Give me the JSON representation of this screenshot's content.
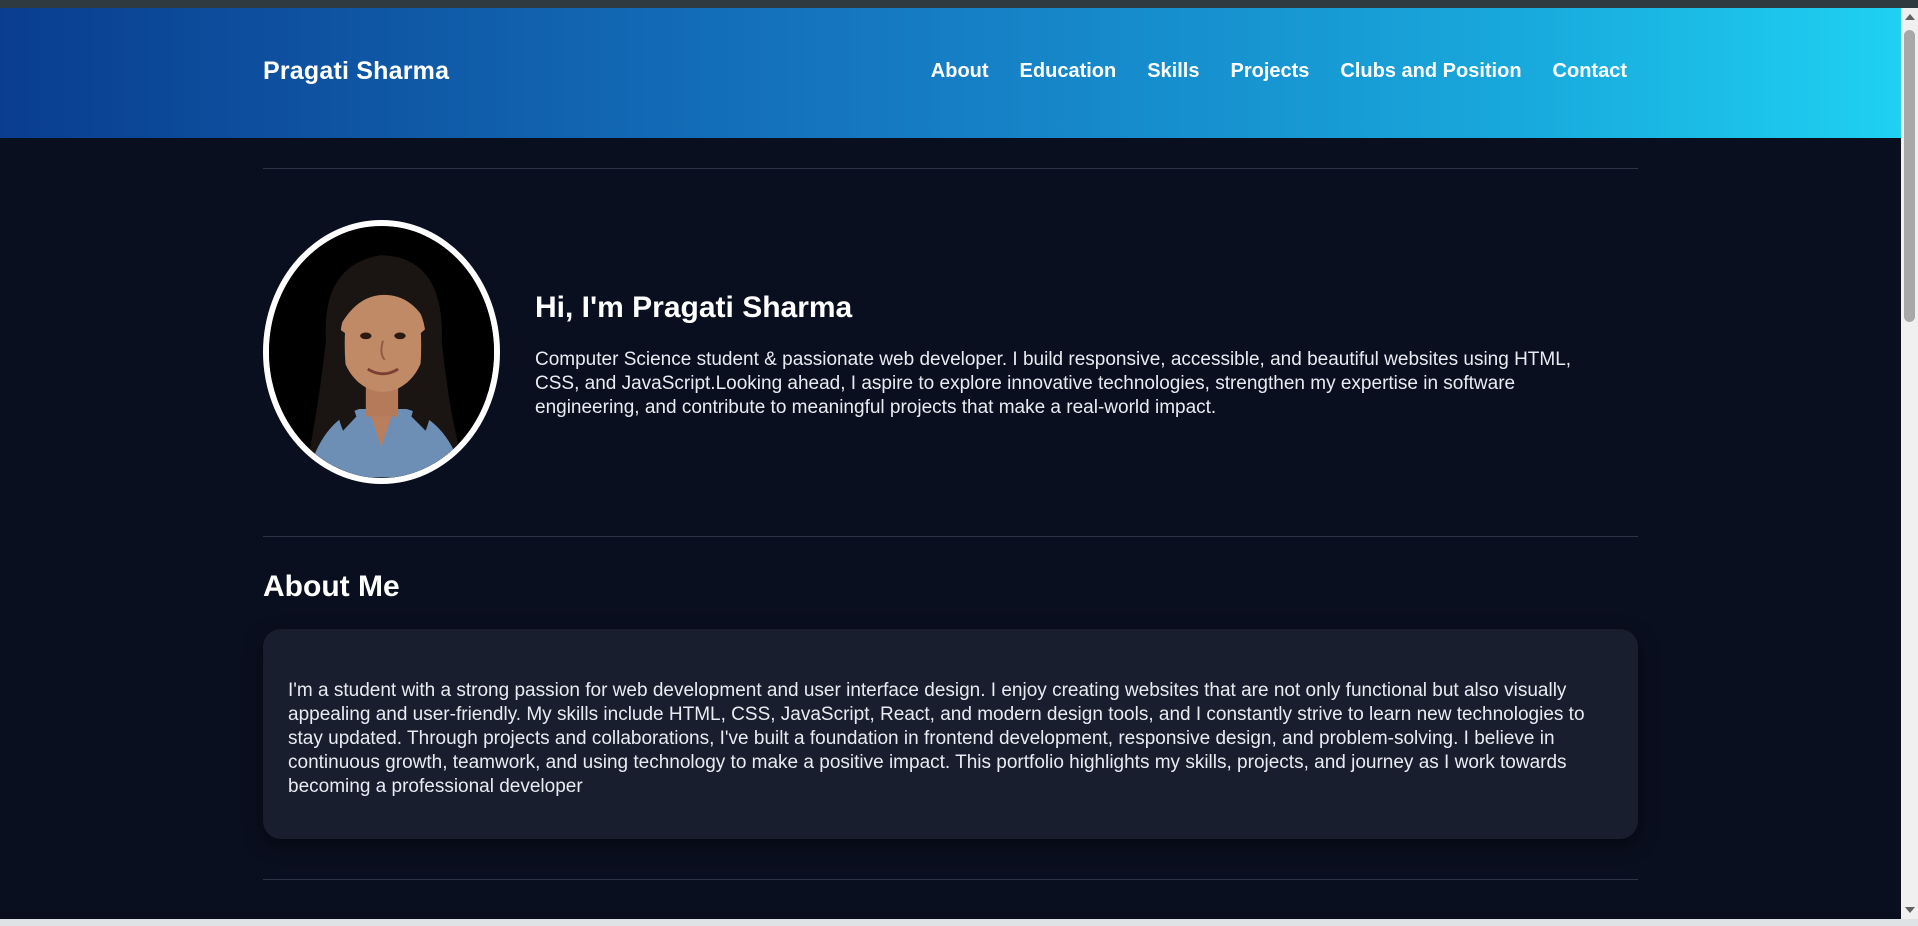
{
  "header": {
    "brand": "Pragati Sharma",
    "nav": [
      {
        "label": "About"
      },
      {
        "label": "Education"
      },
      {
        "label": "Skills"
      },
      {
        "label": "Projects"
      },
      {
        "label": "Clubs and Position"
      },
      {
        "label": "Contact"
      }
    ]
  },
  "hero": {
    "title": "Hi, I'm Pragati Sharma",
    "text": "Computer Science student & passionate web developer. I build responsive, accessible, and beautiful websites using HTML, CSS, and JavaScript.Looking ahead, I aspire to explore innovative technologies, strengthen my expertise in software engineering, and contribute to meaningful projects that make a real-world impact."
  },
  "about": {
    "title": "About Me",
    "text": "I'm a student with a strong passion for web development and user interface design. I enjoy creating websites that are not only functional but also visually appealing and user-friendly. My skills include HTML, CSS, JavaScript, React, and modern design tools, and I constantly strive to learn new technologies to stay updated. Through projects and collaborations, I've built a foundation in frontend development, responsive design, and problem-solving. I believe in continuous growth, teamwork, and using technology to make a positive impact. This portfolio highlights my skills, projects, and journey as I work towards becoming a professional developer"
  },
  "colors": {
    "page_bg": "#0a0f1f",
    "card_bg": "#191e2e",
    "nav_gradient_start": "#0a3d8f",
    "nav_gradient_end": "#1fd1f2"
  }
}
